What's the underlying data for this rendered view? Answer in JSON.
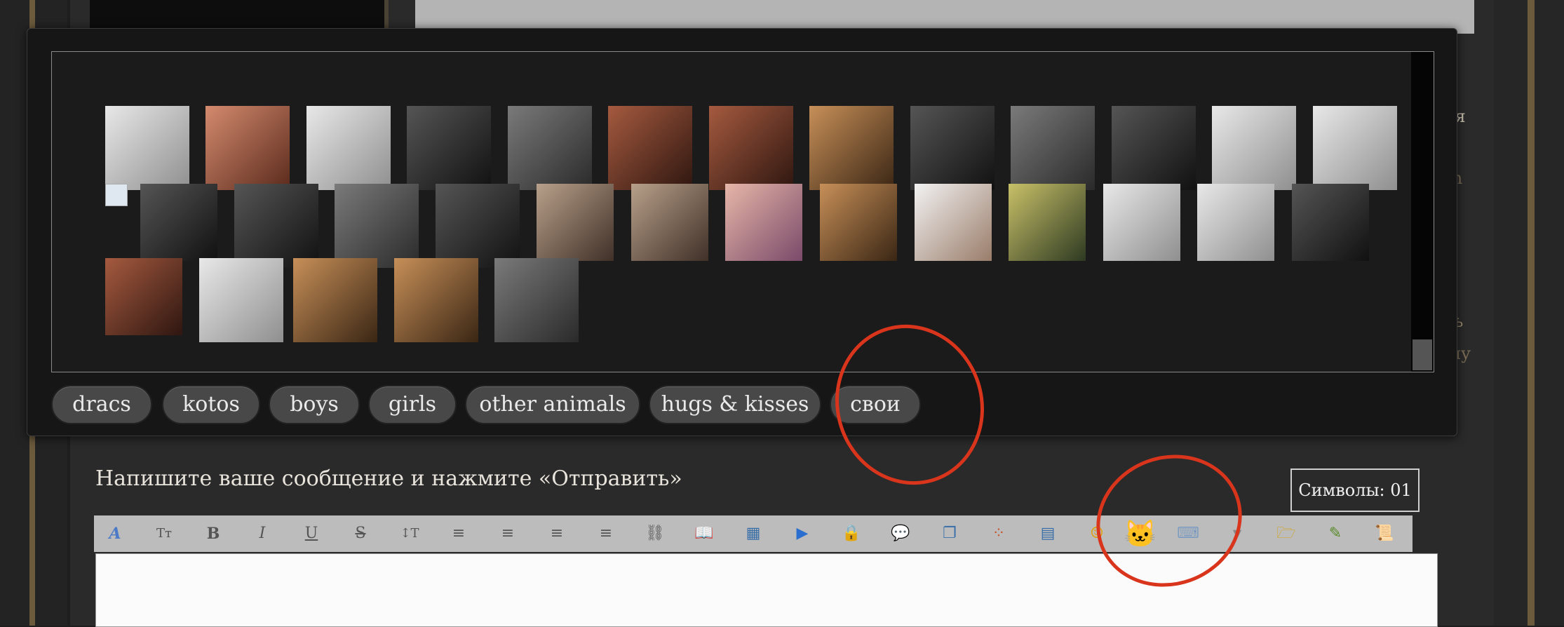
{
  "side_texts": [
    "ься",
    "om",
    "ить",
    "ему"
  ],
  "smiley_tabs": [
    "dracs",
    "kotos",
    "boys",
    "girls",
    "other animals",
    "hugs & kisses",
    "свои"
  ],
  "gallery_thumbs": {
    "row1": [
      "gif-1",
      "gif-2",
      "gif-3",
      "gif-4",
      "gif-5",
      "gif-6",
      "gif-7",
      "gif-8",
      "gif-9",
      "gif-10",
      "gif-11",
      "gif-12",
      "gif-13"
    ],
    "row2": [
      "gif-14",
      "gif-15",
      "gif-16",
      "gif-17",
      "gif-18",
      "gif-19",
      "gif-20",
      "gif-21",
      "gif-22",
      "gif-23",
      "gif-24",
      "gif-25",
      "gif-26"
    ],
    "row3": [
      "gif-27",
      "gif-28",
      "gif-29",
      "gif-30",
      "gif-31"
    ]
  },
  "message": {
    "label": "Напишите ваше сообщение и нажмите «Отправить»",
    "char_count": "Символы: 01"
  },
  "toolbar": {
    "buttons": [
      {
        "icon": "font-color-icon",
        "glyph": "A"
      },
      {
        "icon": "font-size-icon",
        "glyph": "Tт"
      },
      {
        "icon": "bold-icon",
        "glyph": "B"
      },
      {
        "icon": "italic-icon",
        "glyph": "I"
      },
      {
        "icon": "underline-icon",
        "glyph": "U"
      },
      {
        "icon": "strikethrough-icon",
        "glyph": "S"
      },
      {
        "icon": "line-height-icon",
        "glyph": "↕T"
      },
      {
        "icon": "align-left-icon",
        "glyph": "≡"
      },
      {
        "icon": "align-center-icon",
        "glyph": "≡"
      },
      {
        "icon": "align-justify-icon",
        "glyph": "≡"
      },
      {
        "icon": "align-right-icon",
        "glyph": "≡"
      },
      {
        "icon": "link-icon",
        "glyph": "⛓"
      },
      {
        "icon": "book-icon",
        "glyph": "📖"
      },
      {
        "icon": "image-icon",
        "glyph": "▦"
      },
      {
        "icon": "video-icon",
        "glyph": "▶"
      },
      {
        "icon": "lock-icon",
        "glyph": "🔒"
      },
      {
        "icon": "speech-bubble-icon",
        "glyph": "💬"
      },
      {
        "icon": "copy-icon",
        "glyph": "❐"
      },
      {
        "icon": "palette-icon",
        "glyph": "⁘"
      },
      {
        "icon": "table-icon",
        "glyph": "▤"
      },
      {
        "icon": "smiley-icon",
        "glyph": "☺"
      },
      {
        "icon": "cat-sticker-icon",
        "glyph": "🐱"
      },
      {
        "icon": "keyboard-icon",
        "glyph": "⌨"
      },
      {
        "icon": "dropdown-icon",
        "glyph": "▼"
      },
      {
        "icon": "folder-icon",
        "glyph": "🗁"
      },
      {
        "icon": "edit-icon",
        "glyph": "✎"
      },
      {
        "icon": "scroll-icon",
        "glyph": "📜"
      }
    ]
  },
  "colors": {
    "annotation": "#d9341c",
    "popup_bg": "#161616",
    "tab_bg": "#484848",
    "toolbar_bg": "#bcbcbc"
  }
}
